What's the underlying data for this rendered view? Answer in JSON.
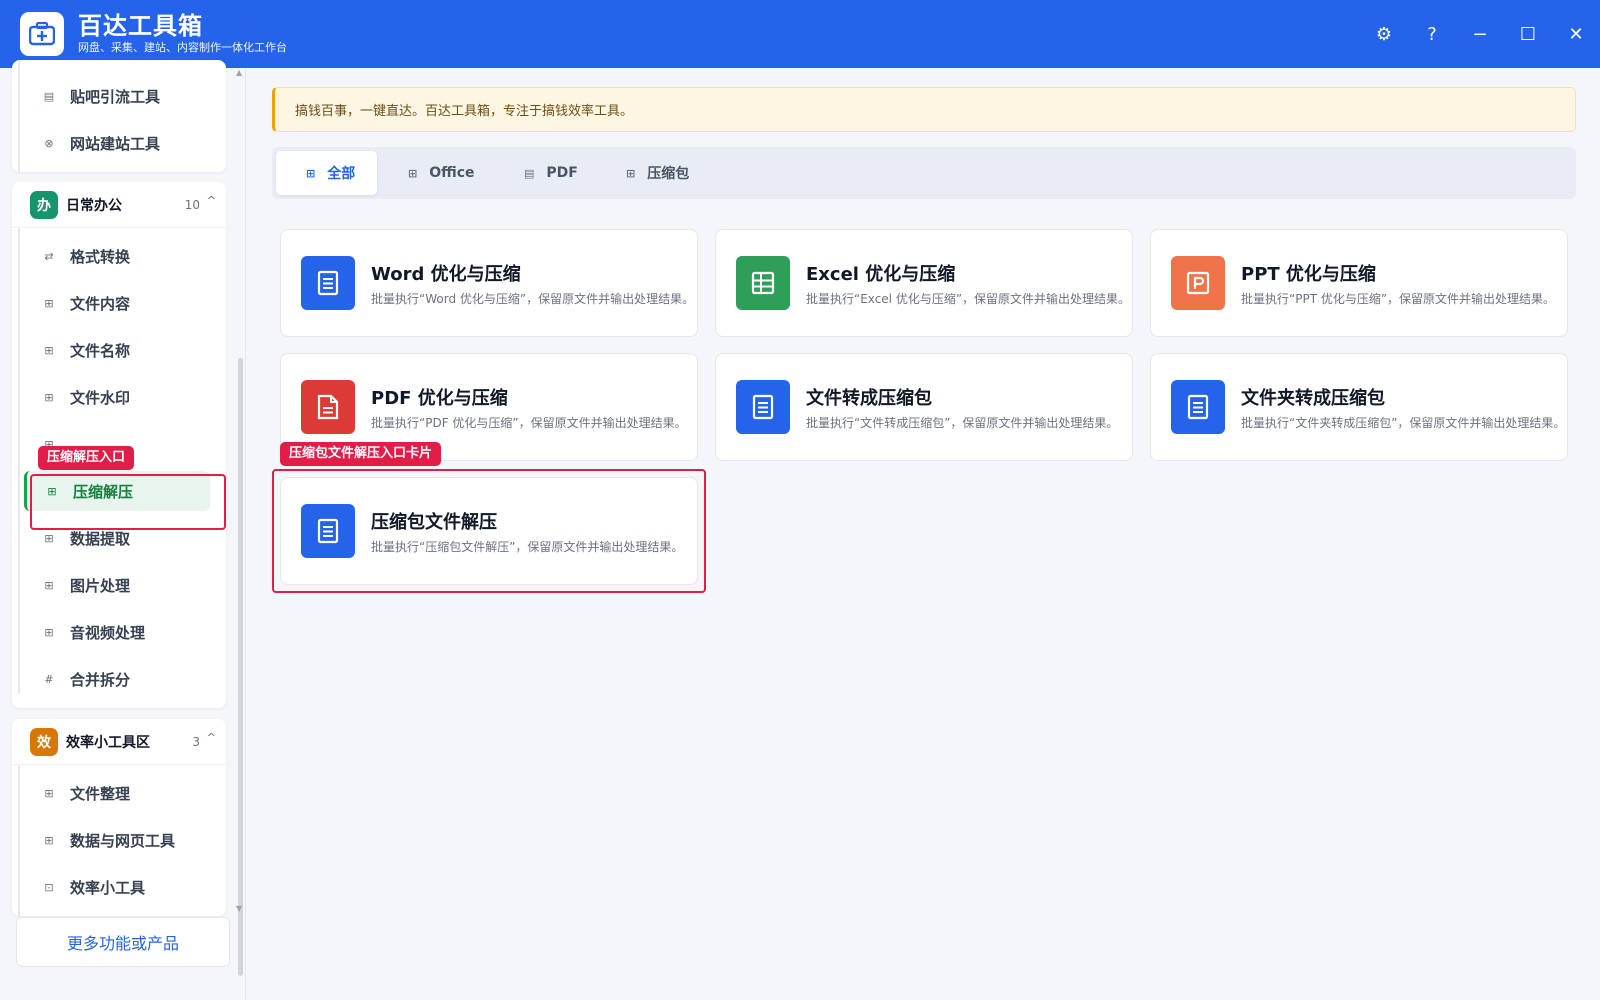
{
  "app": {
    "title": "百达工具箱",
    "subtitle": "网盘、采集、建站、内容制作一体化工作台"
  },
  "window_controls": {
    "settings": "⚙",
    "help": "?",
    "minimize": "−",
    "maximize": "☐",
    "close": "✕"
  },
  "sidebar": {
    "top_items": [
      {
        "label": "贴吧引流工具",
        "icon": "doc-icon"
      },
      {
        "label": "网站建站工具",
        "icon": "globe-icon"
      }
    ],
    "group_office": {
      "badge": "办",
      "title": "日常办公",
      "count": "10",
      "caret": "^",
      "items": [
        {
          "label": "格式转换",
          "icon": "swap-icon"
        },
        {
          "label": "文件内容",
          "icon": "grid-icon"
        },
        {
          "label": "文件名称",
          "icon": "grid-icon"
        },
        {
          "label": "文件水印",
          "icon": "grid-icon"
        },
        {
          "label": "",
          "icon": "grid-icon"
        },
        {
          "label": "压缩解压",
          "icon": "grid-icon",
          "active": true
        },
        {
          "label": "数据提取",
          "icon": "grid-icon"
        },
        {
          "label": "图片处理",
          "icon": "grid-icon"
        },
        {
          "label": "音视频处理",
          "icon": "grid-icon"
        },
        {
          "label": "合并拆分",
          "icon": "hash-icon"
        }
      ]
    },
    "group_efficiency": {
      "badge": "效",
      "title": "效率小工具区",
      "count": "3",
      "caret": "^",
      "items": [
        {
          "label": "文件整理",
          "icon": "grid-icon"
        },
        {
          "label": "数据与网页工具",
          "icon": "grid-icon"
        },
        {
          "label": "效率小工具",
          "icon": "toolbox-icon"
        }
      ]
    },
    "more_button": "更多功能或产品"
  },
  "annotations": {
    "sidebar_tag": "压缩解压入口",
    "card_tag": "压缩包文件解压入口卡片"
  },
  "notice": "搞钱百事，一键直达。百达工具箱，专注于搞钱效率工具。",
  "tabs": [
    {
      "label": "全部",
      "icon": "grid-icon",
      "active": true
    },
    {
      "label": "Office",
      "icon": "grid-icon"
    },
    {
      "label": "PDF",
      "icon": "doc-icon"
    },
    {
      "label": "压缩包",
      "icon": "grid-icon"
    }
  ],
  "cards": [
    {
      "title": "Word 优化与压缩",
      "desc": "批量执行“Word 优化与压缩”，保留原文件并输出处理结果。",
      "color": "#2563eb",
      "icon": "document-icon"
    },
    {
      "title": "Excel 优化与压缩",
      "desc": "批量执行“Excel 优化与压缩”，保留原文件并输出处理结果。",
      "color": "#2f9e58",
      "icon": "spreadsheet-icon"
    },
    {
      "title": "PPT 优化与压缩",
      "desc": "批量执行“PPT 优化与压缩”，保留原文件并输出处理结果。",
      "color": "#f0734a",
      "icon": "presentation-icon"
    },
    {
      "title": "PDF 优化与压缩",
      "desc": "批量执行“PDF 优化与压缩”，保留原文件并输出处理结果。",
      "color": "#dc3a36",
      "icon": "pdf-icon"
    },
    {
      "title": "文件转成压缩包",
      "desc": "批量执行“文件转成压缩包”，保留原文件并输出处理结果。",
      "color": "#2563eb",
      "icon": "document-icon"
    },
    {
      "title": "文件夹转成压缩包",
      "desc": "批量执行“文件夹转成压缩包”，保留原文件并输出处理结果。",
      "color": "#2563eb",
      "icon": "document-icon"
    },
    {
      "title": "压缩包文件解压",
      "desc": "批量执行“压缩包文件解压”，保留原文件并输出处理结果。",
      "color": "#2563eb",
      "icon": "document-icon"
    }
  ]
}
